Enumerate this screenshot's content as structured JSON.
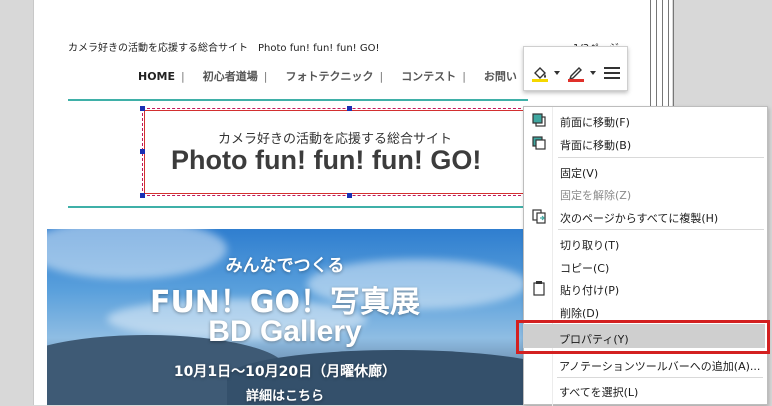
{
  "document": {
    "header_text": "カメラ好きの活動を応援する総合サイト　Photo fun! fun! fun! GO!",
    "page_number": "1/3ページ",
    "nav": [
      "HOME",
      "初心者道場",
      "フォトテクニック",
      "コンテスト",
      "お問い"
    ],
    "nav_separator": "|",
    "banner_subtitle": "カメラ好きの活動を応援する総合サイト",
    "banner_title": "Photo fun! fun! fun! GO!",
    "hero": {
      "line1": "みんなでつくる",
      "line2": "FUN！GO！写真展",
      "line3": "BD Gallery",
      "line4": "10月1日〜10月20日（月曜休廊）",
      "line5": "詳細はこちら"
    }
  },
  "toolbar": {
    "fill_icon": "paint-bucket-icon",
    "pen_icon": "pen-icon",
    "menu_icon": "hamburger-icon",
    "fill_color": "#f5d800",
    "pen_color": "#e0302a"
  },
  "context_menu": {
    "items": [
      {
        "label": "前面に移動(F)",
        "icon": "bring-forward-icon",
        "enabled": true
      },
      {
        "label": "背面に移動(B)",
        "icon": "send-backward-icon",
        "enabled": true
      },
      {
        "label": "固定(V)",
        "icon": "",
        "enabled": true
      },
      {
        "label": "固定を解除(Z)",
        "icon": "",
        "enabled": false
      },
      {
        "label": "次のページからすべてに複製(H)",
        "icon": "duplicate-pages-icon",
        "enabled": true
      },
      {
        "label": "切り取り(T)",
        "icon": "",
        "enabled": true
      },
      {
        "label": "コピー(C)",
        "icon": "",
        "enabled": true
      },
      {
        "label": "貼り付け(P)",
        "icon": "clipboard-icon",
        "enabled": true
      },
      {
        "label": "削除(D)",
        "icon": "",
        "enabled": true
      },
      {
        "label": "プロパティ(Y)",
        "icon": "",
        "enabled": true,
        "highlighted": true
      },
      {
        "label": "アノテーションツールバーへの追加(A)...",
        "icon": "",
        "enabled": true
      },
      {
        "label": "すべてを選択(L)",
        "icon": "",
        "enabled": true
      }
    ]
  },
  "colors": {
    "accent_teal": "#3fb0a8",
    "highlight_red": "#d32020",
    "selection_blue": "#1a2fb3"
  }
}
